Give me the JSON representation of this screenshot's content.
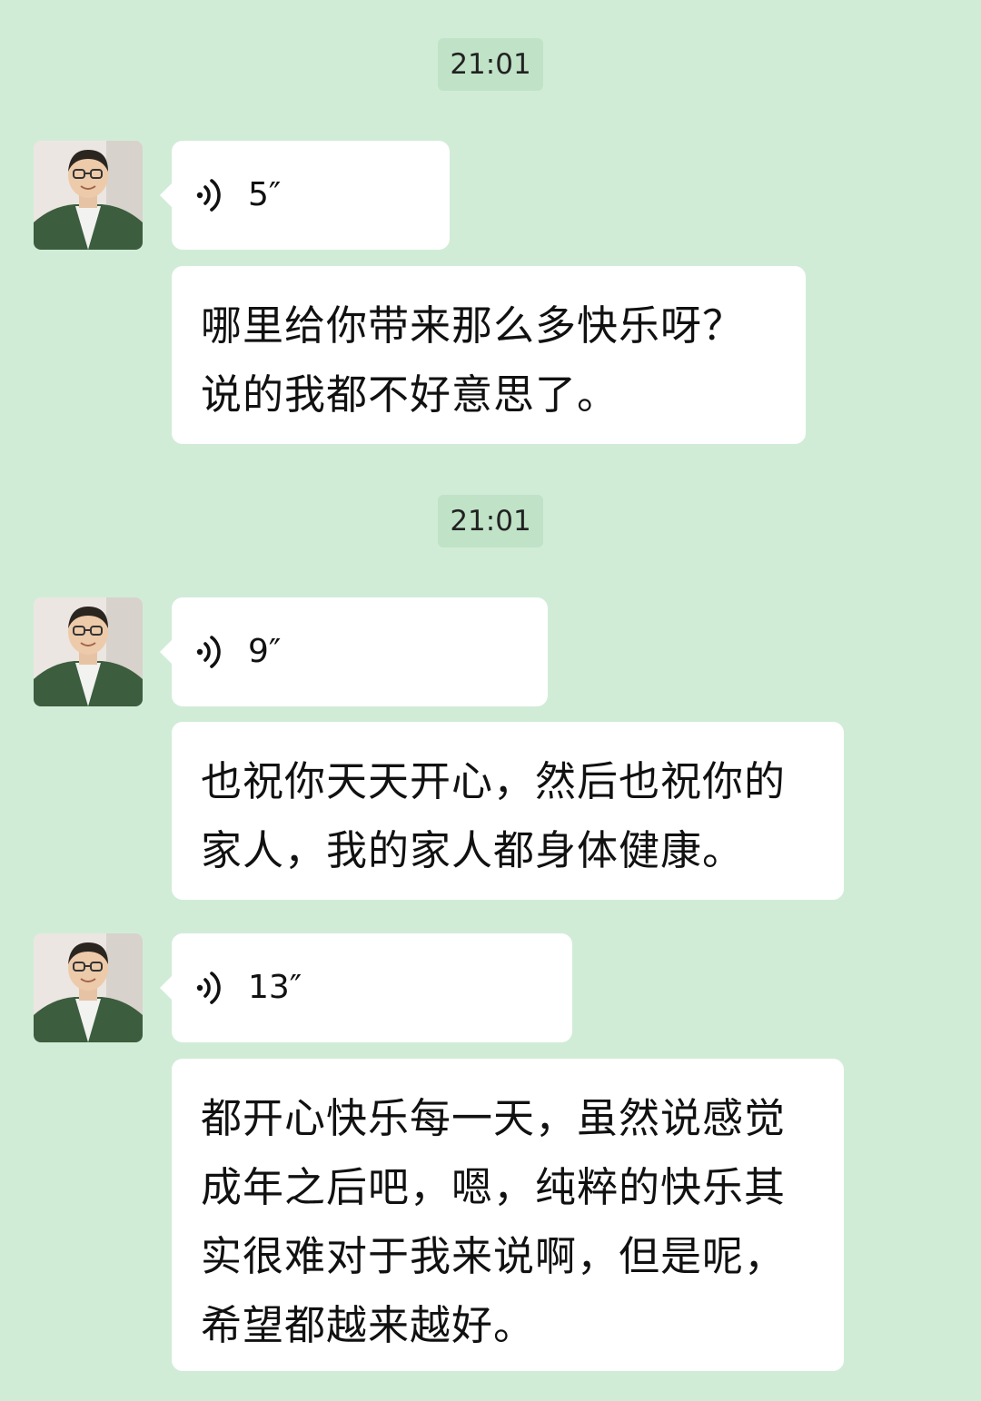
{
  "messages": [
    {
      "type": "timestamp",
      "text": "21:01"
    },
    {
      "type": "voice",
      "sender": "contact",
      "duration": "5″"
    },
    {
      "type": "text",
      "sender": "contact",
      "text": "哪里给你带来那么多快乐呀？说的我都不好意思了。"
    },
    {
      "type": "timestamp",
      "text": "21:01"
    },
    {
      "type": "voice",
      "sender": "contact",
      "duration": "9″"
    },
    {
      "type": "text",
      "sender": "contact",
      "text": "也祝你天天开心，然后也祝你的家人，我的家人都身体健康。"
    },
    {
      "type": "voice",
      "sender": "contact",
      "duration": "13″"
    },
    {
      "type": "text",
      "sender": "contact",
      "text": "都开心快乐每一天，虽然说感觉成年之后吧，嗯，纯粹的快乐其实很难对于我来说啊，但是呢，希望都越来越好。"
    }
  ],
  "colors": {
    "background": "#d1ecd6",
    "timestamp_bg": "#c0e3c7",
    "bubble": "#ffffff"
  }
}
